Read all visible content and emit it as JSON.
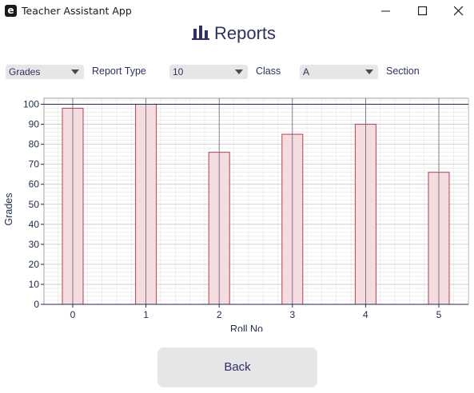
{
  "window": {
    "title": "Teacher Assistant App",
    "icon_letter": "e"
  },
  "header": {
    "title": "Reports",
    "icon": "bar-chart-icon"
  },
  "controls": {
    "report_type": {
      "value": "Grades",
      "label": "Report Type"
    },
    "class": {
      "value": "10",
      "label": "Class"
    },
    "section": {
      "value": "A",
      "label": "Section"
    }
  },
  "chart_data": {
    "type": "bar",
    "categories": [
      "0",
      "1",
      "2",
      "3",
      "4",
      "5"
    ],
    "values": [
      98,
      100,
      76,
      85,
      90,
      66
    ],
    "xlabel": "Roll No",
    "ylabel": "Grades",
    "ylim": [
      0,
      103
    ],
    "yticks": [
      0,
      10,
      20,
      30,
      40,
      50,
      60,
      70,
      80,
      90,
      100
    ],
    "grid": true,
    "colors": {
      "bar_fill": "#f5dcde",
      "bar_edge": "#b4414b",
      "axis": "#1e2a4a",
      "grid": "#c8c8c8"
    }
  },
  "footer": {
    "back_label": "Back"
  }
}
